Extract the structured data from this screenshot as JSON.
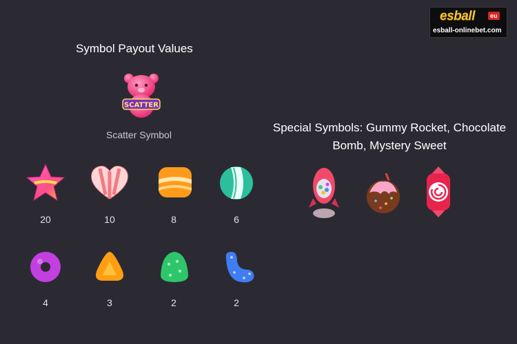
{
  "logo": {
    "brand": "esball",
    "badge": "eu",
    "url": "esball-onlinebet.com"
  },
  "title": "Symbol Payout Values",
  "scatter": {
    "icon_text": "SCATTER",
    "label": "Scatter Symbol"
  },
  "special": {
    "title_line1": "Special Symbols: Gummy Rocket, Chocolate",
    "title_line2": "Bomb, Mystery Sweet",
    "icons": [
      "gummy-rocket-icon",
      "chocolate-bomb-icon",
      "mystery-sweet-icon"
    ]
  },
  "symbols": [
    {
      "name": "star-candy-icon",
      "value": "20"
    },
    {
      "name": "heart-candy-icon",
      "value": "10"
    },
    {
      "name": "square-candy-icon",
      "value": "8"
    },
    {
      "name": "ball-candy-icon",
      "value": "6"
    },
    {
      "name": "donut-candy-icon",
      "value": "4"
    },
    {
      "name": "triangle-candy-icon",
      "value": "3"
    },
    {
      "name": "gumdrop-candy-icon",
      "value": "2"
    },
    {
      "name": "jelly-bean-candy-icon",
      "value": "2"
    }
  ]
}
